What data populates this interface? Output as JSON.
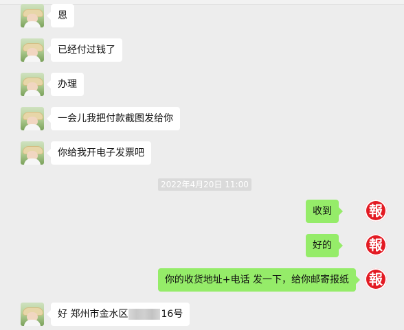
{
  "messages": {
    "m1": {
      "text": "恩"
    },
    "m2": {
      "text": "已经付过钱了"
    },
    "m3": {
      "text": "办理"
    },
    "m4": {
      "text": "一会儿我把付款截图发给你"
    },
    "m5": {
      "text": "你给我开电子发票吧"
    },
    "timestamp": "2022年4月20日 11:00",
    "r1": {
      "text": "收到"
    },
    "r2": {
      "text": "好的"
    },
    "r3": {
      "text": "你的收货地址+电话 发一下，给你邮寄报纸"
    },
    "m6": {
      "prefix": "好  郑州市金水区",
      "suffix": "16号"
    }
  },
  "seal_text": "報",
  "colors": {
    "background": "#ededed",
    "left_bubble": "#ffffff",
    "right_bubble": "#95ec69",
    "seal": "#e31b23",
    "timestamp_bg": "#dadada"
  }
}
